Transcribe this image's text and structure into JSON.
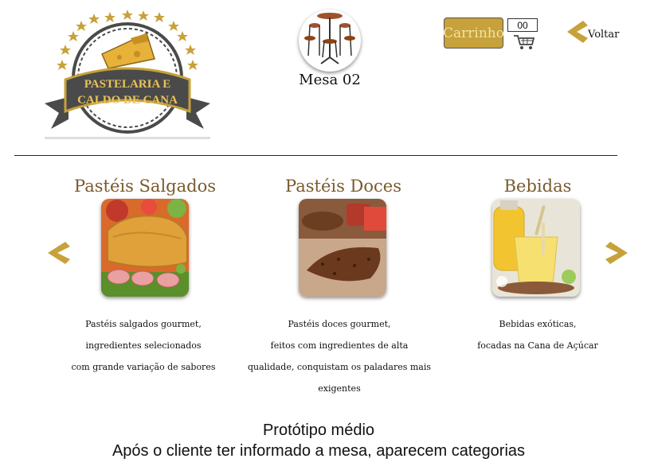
{
  "header": {
    "logo_text_line1": "PASTELARIA E",
    "logo_text_line2": "CALDO DE CANA",
    "table_label": "Mesa 02",
    "cart_label": "Carrinho",
    "cart_count": "00",
    "back_label": "Voltar"
  },
  "categories": [
    {
      "title": "Pastéis Salgados",
      "desc_lines": [
        "Pastéis salgados gourmet,",
        "ingredientes selecionados",
        "com grande variação de sabores"
      ]
    },
    {
      "title": "Pastéis Doces",
      "desc_lines": [
        "Pastéis doces gourmet,",
        "feitos com ingredientes de alta",
        "qualidade, conquistam os paladares mais exigentes"
      ]
    },
    {
      "title": "Bebidas",
      "desc_lines": [
        "Bebidas exóticas,",
        "focadas na Cana de Açúcar"
      ]
    }
  ],
  "caption": {
    "line1": "Protótipo médio",
    "line2": "Após o cliente ter informado a mesa, aparecem categorias"
  },
  "colors": {
    "accent_gold": "#c7a13a",
    "title_brown": "#7a5a2c",
    "logo_dark": "#4a4a4a"
  }
}
